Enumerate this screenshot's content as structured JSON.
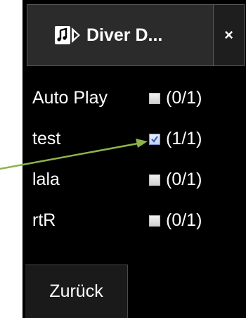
{
  "window": {
    "title": "Diver D...",
    "close_glyph": "×",
    "app_icon": "music-slideshow-icon"
  },
  "items": [
    {
      "label": "Auto Play",
      "checked": false,
      "count": "(0/1)"
    },
    {
      "label": "test",
      "checked": true,
      "count": "(1/1)"
    },
    {
      "label": "lala",
      "checked": false,
      "count": "(0/1)"
    },
    {
      "label": "rtR",
      "checked": false,
      "count": "(0/1)"
    }
  ],
  "back_button": {
    "label": "Zurück"
  },
  "annotation": {
    "arrow_color": "#8db34a",
    "target": "test checkbox"
  },
  "colors": {
    "panel_bg": "#000000",
    "title_bg": "#2b2b2b",
    "text": "#ffffff",
    "check_accent": "#3a5fb5"
  }
}
